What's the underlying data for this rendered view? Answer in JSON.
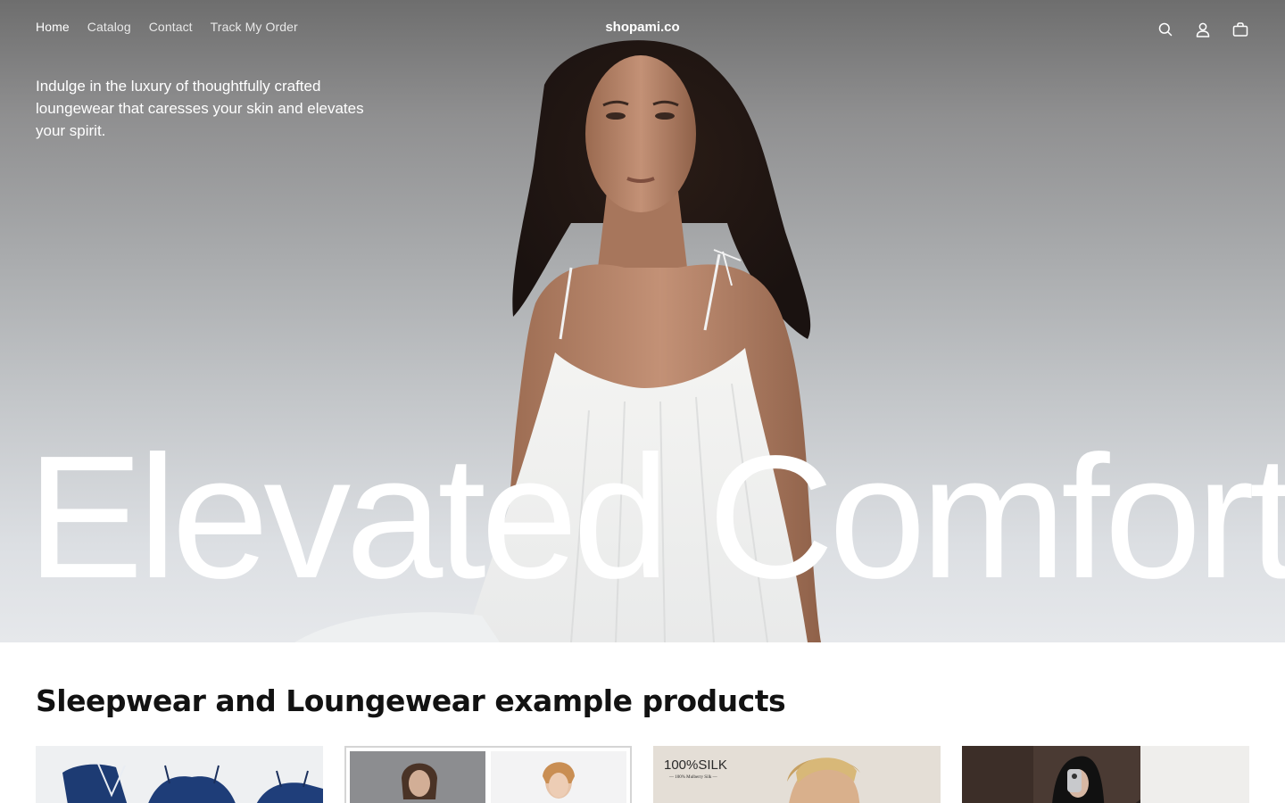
{
  "nav": {
    "links": [
      {
        "label": "Home",
        "active": true
      },
      {
        "label": "Catalog",
        "active": false
      },
      {
        "label": "Contact",
        "active": false
      },
      {
        "label": "Track My Order",
        "active": false
      }
    ],
    "brand": "shopami.co",
    "icons": [
      "search-icon",
      "account-icon",
      "cart-icon"
    ]
  },
  "hero": {
    "tagline": "Indulge in the luxury of thoughtfully crafted loungewear that caresses your skin and elevates your spirit.",
    "title": "Elevated Comfort"
  },
  "products": {
    "title": "Sleepwear and Loungewear example products",
    "cards": [
      {
        "image": "navy-satin-pajama-set"
      },
      {
        "image": "pajama-models-collage"
      },
      {
        "image": "silk-model",
        "overlay_text": "100%SILK",
        "overlay_sub": "— 100% Mulberry Silk —"
      },
      {
        "image": "mirror-selfie"
      }
    ]
  },
  "colors": {
    "text": "#121212",
    "hero_text": "#ffffff",
    "background": "#ffffff"
  }
}
